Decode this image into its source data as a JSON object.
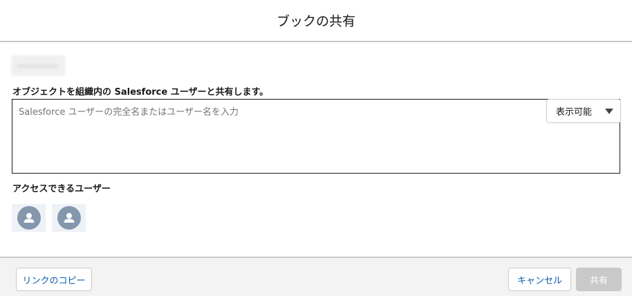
{
  "header": {
    "title": "ブックの共有"
  },
  "share": {
    "label": "オブジェクトを組織内の Salesforce ユーザーと共有します。",
    "input_value": "",
    "input_placeholder": "Salesforce ユーザーの完全名またはユーザー名を入力",
    "permission_selected": "表示可能"
  },
  "access": {
    "label": "アクセスできるユーザー",
    "avatars": [
      "user-icon",
      "user-icon"
    ]
  },
  "footer": {
    "copy_link_label": "リンクのコピー",
    "cancel_label": "キャンセル",
    "share_label": "共有"
  },
  "colors": {
    "brand_text": "#0b5cab",
    "avatar": "#8497ad",
    "disabled_button": "#c9c9c9"
  }
}
